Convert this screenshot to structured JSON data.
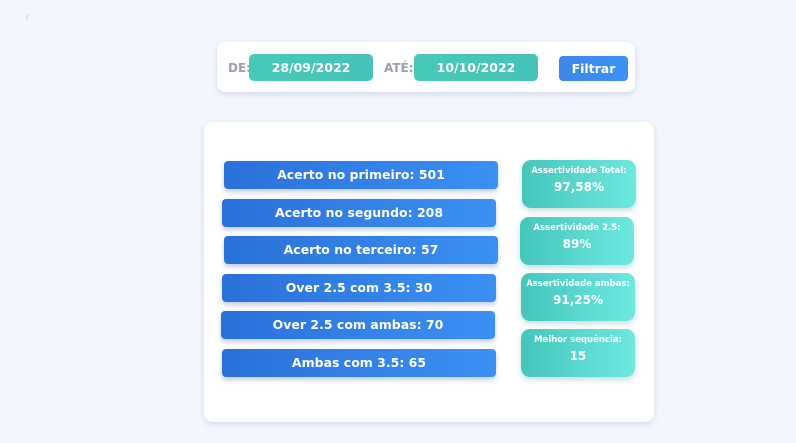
{
  "corner_mark": "/",
  "filter": {
    "from_label": "DE:",
    "from_value": "28/09/2022",
    "to_label": "ATÉ:",
    "to_value": "10/10/2022",
    "button_label": "Filtrar"
  },
  "stats": [
    {
      "label": "Acerto no primeiro: 501"
    },
    {
      "label": "Acerto no segundo: 208"
    },
    {
      "label": "Acerto no terceiro: 57"
    },
    {
      "label": "Over 2.5 com 3.5: 30"
    },
    {
      "label": "Over 2.5 com ambas: 70"
    },
    {
      "label": "Ambas com 3.5: 65"
    }
  ],
  "kpis": [
    {
      "label": "Assertividade Total:",
      "value": "97,58%"
    },
    {
      "label": "Assertividade 2.5:",
      "value": "89%"
    },
    {
      "label": "Assertividade ambas:",
      "value": "91,25%"
    },
    {
      "label": "Melhor sequência:",
      "value": "15"
    }
  ],
  "colors": {
    "page_background": "#f3f6fd",
    "date_field": "#47c9b8",
    "filter_button": "#3f86ea",
    "stat_row_start": "#2a71da",
    "stat_row_end": "#3b90f4",
    "kpi_start": "#45c6bb",
    "kpi_end": "#6ee8e0",
    "label_gray": "#9aa1ad"
  }
}
